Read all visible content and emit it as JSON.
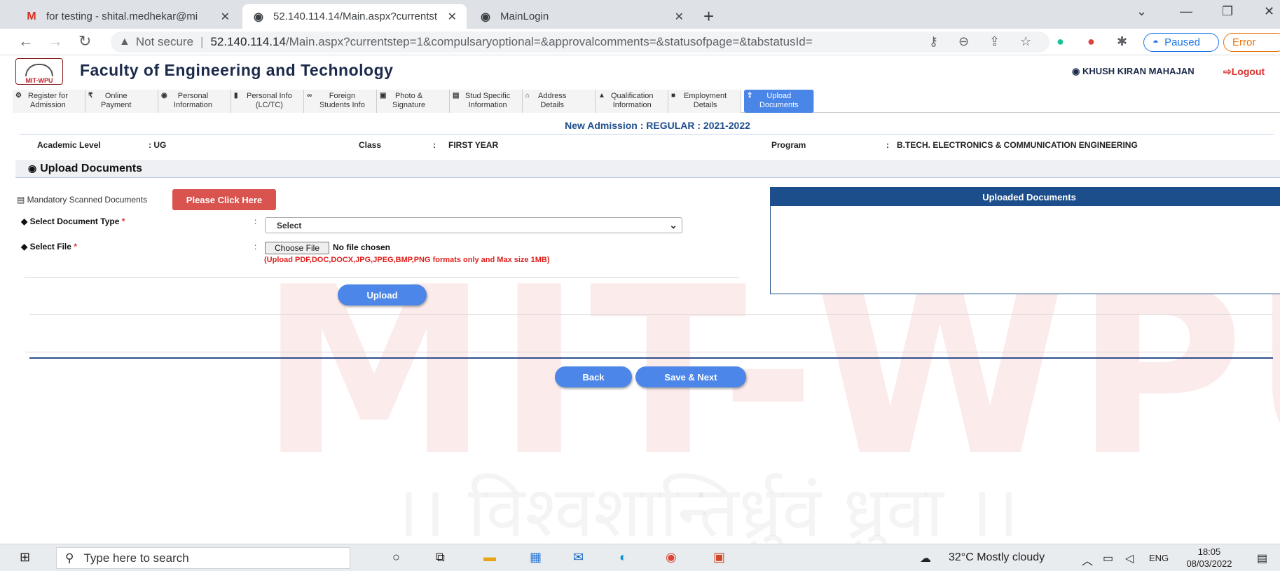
{
  "browser": {
    "tabs": [
      {
        "icon": "gmail-icon",
        "glyph": "M",
        "title": "for testing - shital.medhekar@mi",
        "close": "✕"
      },
      {
        "icon": "globe-icon",
        "glyph": "◉",
        "title": "52.140.114.14/Main.aspx?currentst",
        "close": "✕"
      },
      {
        "icon": "globe-icon",
        "glyph": "◉",
        "title": "MainLogin",
        "close": "✕"
      }
    ],
    "new_tab": "+",
    "address": {
      "security": "Not secure",
      "host": "52.140.114.14",
      "path": "/Main.aspx?currentstep=1&compulsaryoptional=&approvalcomments=&statusofpage=&tabstatusId="
    },
    "profile_pill": "Paused",
    "error_pill": "Error"
  },
  "header": {
    "logo_text": "MIT-WPU",
    "title": "Faculty of Engineering and Technology",
    "user": "KHUSH KIRAN MAHAJAN",
    "logout": "Logout"
  },
  "steps": [
    {
      "icon": "dashboard-icon",
      "glyph": "⚙",
      "label1": "Register for",
      "label2": "Admission"
    },
    {
      "icon": "rupee-icon",
      "glyph": "₹",
      "label1": "Online",
      "label2": "Payment"
    },
    {
      "icon": "user-circle-icon",
      "glyph": "◉",
      "label1": "Personal",
      "label2": "Information"
    },
    {
      "icon": "bookmark-icon",
      "glyph": "▮",
      "label1": "Personal Info",
      "label2": "(LC/TC)"
    },
    {
      "icon": "glasses-icon",
      "glyph": "∞",
      "label1": "Foreign",
      "label2": "Students Info"
    },
    {
      "icon": "photo-icon",
      "glyph": "▣",
      "label1": "Photo &",
      "label2": "Signature"
    },
    {
      "icon": "id-card-icon",
      "glyph": "▤",
      "label1": "Stud Specific",
      "label2": "Information"
    },
    {
      "icon": "home-icon",
      "glyph": "⌂",
      "label1": "Address",
      "label2": "Details"
    },
    {
      "icon": "graduation-cap-icon",
      "glyph": "▲",
      "label1": "Qualification",
      "label2": "Information"
    },
    {
      "icon": "briefcase-icon",
      "glyph": "■",
      "label1": "Employment",
      "label2": "Details"
    },
    {
      "icon": "upload-icon",
      "glyph": "⇪",
      "label1": "Upload",
      "label2": "Documents"
    }
  ],
  "admission": {
    "title": "New Admission : REGULAR : 2021-2022",
    "academic_level_label": "Academic Level",
    "academic_level_value": ": UG",
    "class_label": "Class",
    "class_value": "FIRST YEAR",
    "program_label": "Program",
    "program_value": "B.TECH. ELECTRONICS & COMMUNICATION ENGINEERING",
    "sep": ":"
  },
  "upload": {
    "section_title": "Upload Documents",
    "mandatory_label": "Mandatory Scanned Documents",
    "click_here": "Please Click Here",
    "doc_type_label": "Select Document Type",
    "file_label": "Select File",
    "required_mark": "*",
    "select_value": "Select",
    "choose_file": "Choose File",
    "no_file": "No file chosen",
    "hint": "(Upload PDF,DOC,DOCX,JPG,JPEG,BMP,PNG formats only and Max size 1MB)",
    "upload_button": "Upload",
    "uploaded_title": "Uploaded Documents"
  },
  "actions": {
    "back": "Back",
    "save_next": "Save & Next"
  },
  "watermark": {
    "main": "MIT-WPU",
    "sub": "।। विश्वशान्तिर्ध्रुवं ध्रुवा ।।"
  },
  "taskbar": {
    "search_placeholder": "Type here to search",
    "weather": "32°C  Mostly cloudy",
    "lang": "ENG",
    "time": "18:05",
    "date": "08/03/2022"
  },
  "colors": {
    "accent": "#4b86e8",
    "navy": "#1d4e8c",
    "danger": "#d9534f"
  }
}
